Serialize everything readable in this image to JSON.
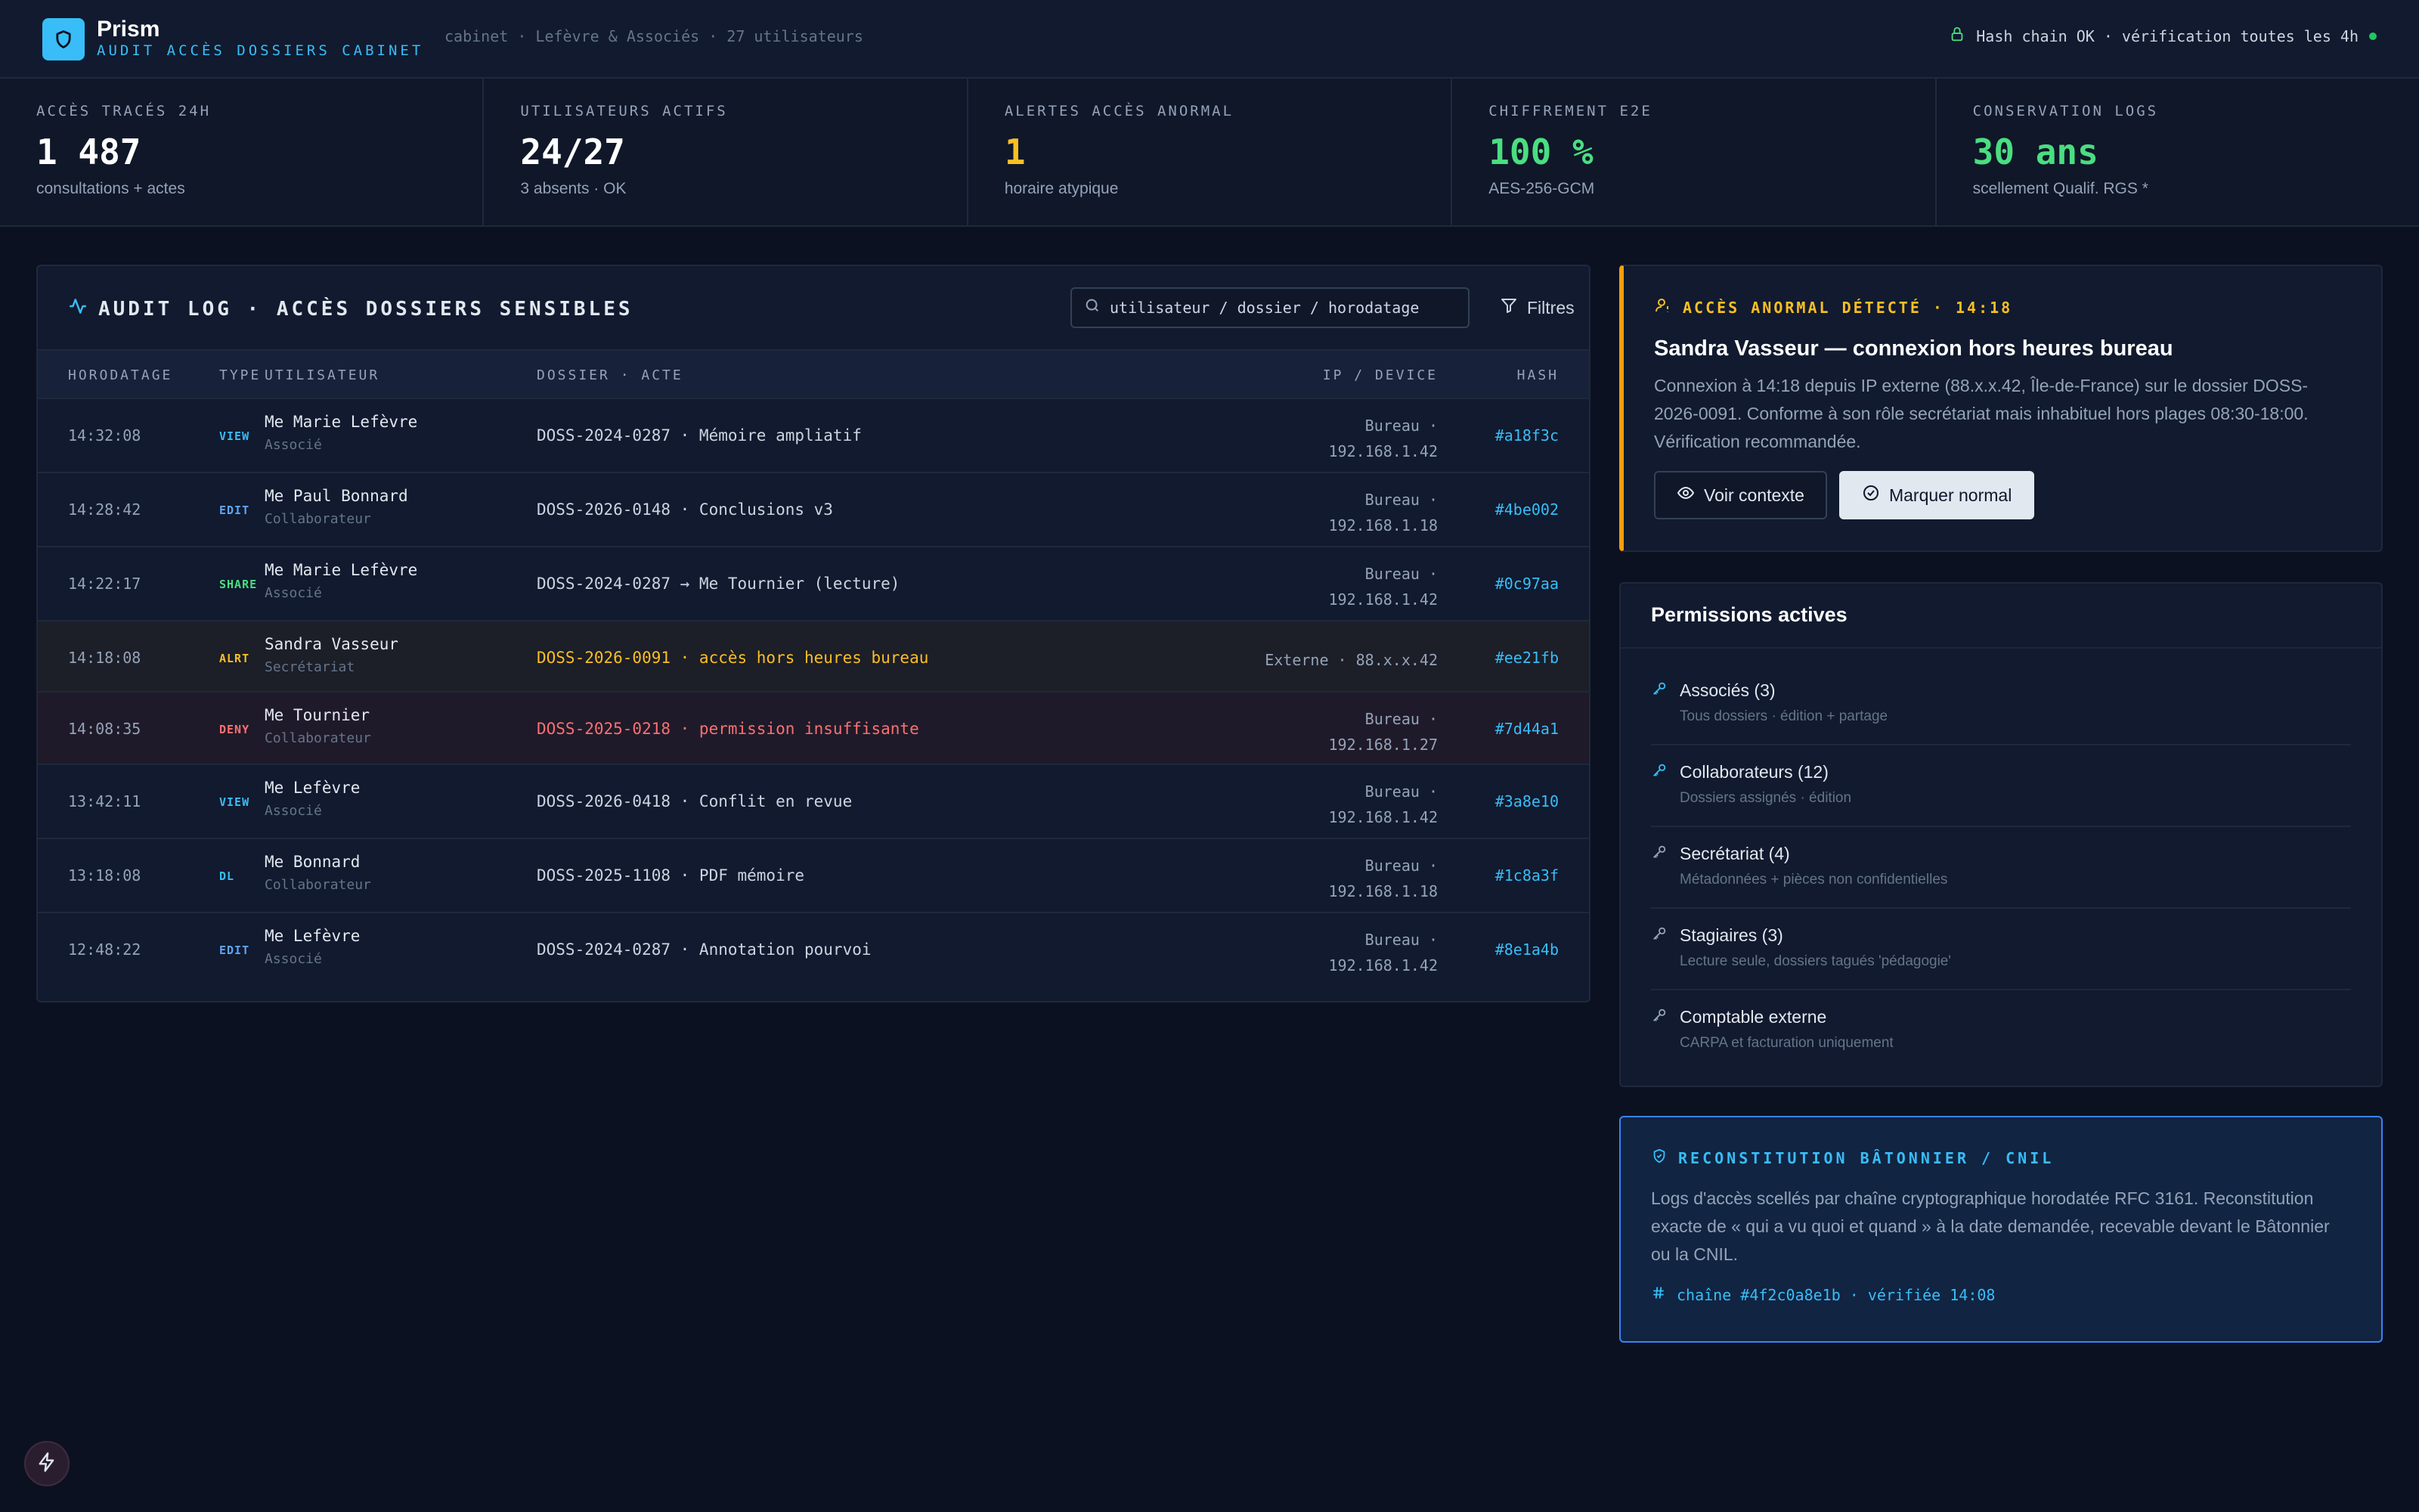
{
  "header": {
    "brand": "Prism",
    "subtitle": "AUDIT ACCÈS DOSSIERS CABINET",
    "meta": "cabinet · Lefèvre & Associés · 27 utilisateurs",
    "status": "Hash chain OK · vérification toutes les 4h"
  },
  "stats": [
    {
      "label": "ACCÈS TRACÉS 24H",
      "value": "1 487",
      "sub": "consultations + actes",
      "color": "#ffffff"
    },
    {
      "label": "UTILISATEURS ACTIFS",
      "value": "24/27",
      "sub": "3 absents · OK",
      "color": "#ffffff"
    },
    {
      "label": "ALERTES ACCÈS ANORMAL",
      "value": "1",
      "sub": "horaire atypique",
      "color": "#fbbf24"
    },
    {
      "label": "CHIFFREMENT E2E",
      "value": "100 %",
      "sub": "AES-256-GCM",
      "color": "#4ade80"
    },
    {
      "label": "CONSERVATION LOGS",
      "value": "30 ans",
      "sub": "scellement Qualif. RGS *",
      "color": "#4ade80"
    }
  ],
  "audit": {
    "title": "AUDIT LOG · ACCÈS DOSSIERS SENSIBLES",
    "search_placeholder": "utilisateur / dossier / horodatage",
    "filter_label": "Filtres",
    "columns": {
      "time": "HORODATAGE",
      "type": "TYPE",
      "user": "UTILISATEUR",
      "dossier": "DOSSIER · ACTE",
      "ip": "IP / DEVICE",
      "hash": "HASH"
    },
    "rows": [
      {
        "time": "14:32:08",
        "type": "VIEW",
        "type_color": "#38bdf8",
        "user": "Me Marie Lefèvre",
        "role": "Associé",
        "dossier": "DOSS-2024-0287 · Mémoire ampliatif",
        "dossier_color": "#cbd5e1",
        "ip1": "Bureau ·",
        "ip2": "192.168.1.42",
        "hash": "#a18f3c"
      },
      {
        "time": "14:28:42",
        "type": "EDIT",
        "type_color": "#60a5fa",
        "user": "Me Paul Bonnard",
        "role": "Collaborateur",
        "dossier": "DOSS-2026-0148 · Conclusions v3",
        "dossier_color": "#cbd5e1",
        "ip1": "Bureau ·",
        "ip2": "192.168.1.18",
        "hash": "#4be002"
      },
      {
        "time": "14:22:17",
        "type": "SHARE",
        "type_color": "#4ade80",
        "user": "Me Marie Lefèvre",
        "role": "Associé",
        "dossier": "DOSS-2024-0287 → Me Tournier (lecture)",
        "dossier_color": "#cbd5e1",
        "ip1": "Bureau ·",
        "ip2": "192.168.1.42",
        "hash": "#0c97aa"
      },
      {
        "time": "14:18:08",
        "type": "ALRT",
        "type_color": "#fbbf24",
        "user": "Sandra Vasseur",
        "role": "Secrétariat",
        "dossier": "DOSS-2026-0091 · accès hors heures bureau",
        "dossier_color": "#fbbf24",
        "ip1": "Externe · 88.x.x.42",
        "ip2": "",
        "hash": "#ee21fb"
      },
      {
        "time": "14:08:35",
        "type": "DENY",
        "type_color": "#f87171",
        "user": "Me Tournier",
        "role": "Collaborateur",
        "dossier": "DOSS-2025-0218 · permission insuffisante",
        "dossier_color": "#f87171",
        "ip1": "Bureau ·",
        "ip2": "192.168.1.27",
        "hash": "#7d44a1"
      },
      {
        "time": "13:42:11",
        "type": "VIEW",
        "type_color": "#38bdf8",
        "user": "Me Lefèvre",
        "role": "Associé",
        "dossier": "DOSS-2026-0418 · Conflit en revue",
        "dossier_color": "#cbd5e1",
        "ip1": "Bureau ·",
        "ip2": "192.168.1.42",
        "hash": "#3a8e10"
      },
      {
        "time": "13:18:08",
        "type": "DL",
        "type_color": "#38bdf8",
        "user": "Me Bonnard",
        "role": "Collaborateur",
        "dossier": "DOSS-2025-1108 · PDF mémoire",
        "dossier_color": "#cbd5e1",
        "ip1": "Bureau ·",
        "ip2": "192.168.1.18",
        "hash": "#1c8a3f"
      },
      {
        "time": "12:48:22",
        "type": "EDIT",
        "type_color": "#60a5fa",
        "user": "Me Lefèvre",
        "role": "Associé",
        "dossier": "DOSS-2024-0287 · Annotation pourvoi",
        "dossier_color": "#cbd5e1",
        "ip1": "Bureau ·",
        "ip2": "192.168.1.42",
        "hash": "#8e1a4b"
      }
    ]
  },
  "alert": {
    "label": "ACCÈS ANORMAL DÉTECTÉ · 14:18",
    "title": "Sandra Vasseur — connexion hors heures bureau",
    "body": "Connexion à 14:18 depuis IP externe (88.x.x.42, Île-de-France) sur le dossier DOSS-2026-0091. Conforme à son rôle secrétariat mais inhabituel hors plages 08:30-18:00. Vérification recommandée.",
    "btn_context": "Voir contexte",
    "btn_normal": "Marquer normal"
  },
  "permissions": {
    "title": "Permissions actives",
    "items": [
      {
        "name": "Associés (3)",
        "desc": "Tous dossiers · édition + partage",
        "icon_color": "#38bdf8"
      },
      {
        "name": "Collaborateurs (12)",
        "desc": "Dossiers assignés · édition",
        "icon_color": "#38bdf8"
      },
      {
        "name": "Secrétariat (4)",
        "desc": "Métadonnées + pièces non confidentielles",
        "icon_color": "#94a3b8"
      },
      {
        "name": "Stagiaires (3)",
        "desc": "Lecture seule, dossiers tagués 'pédagogie'",
        "icon_color": "#94a3b8"
      },
      {
        "name": "Comptable externe",
        "desc": "CARPA et facturation uniquement",
        "icon_color": "#94a3b8"
      }
    ]
  },
  "cnil": {
    "label": "RECONSTITUTION BÂTONNIER / CNIL",
    "body": "Logs d'accès scellés par chaîne cryptographique horodatée RFC 3161. Reconstitution exacte de « qui a vu quoi et quand » à la date demandée, recevable devant le Bâtonnier ou la CNIL.",
    "chain": "chaîne #4f2c0a8e1b · vérifiée 14:08"
  },
  "icons": {
    "logo": "shield-icon",
    "status": "lock-icon",
    "audit": "activity-icon",
    "search": "search-icon",
    "filter": "filter-icon",
    "alert": "user-alert-icon",
    "eye": "eye-icon",
    "check": "check-circle-icon",
    "key": "key-icon",
    "cnil": "shield-check-icon",
    "hash": "hash-icon",
    "fab": "bolt-icon"
  }
}
